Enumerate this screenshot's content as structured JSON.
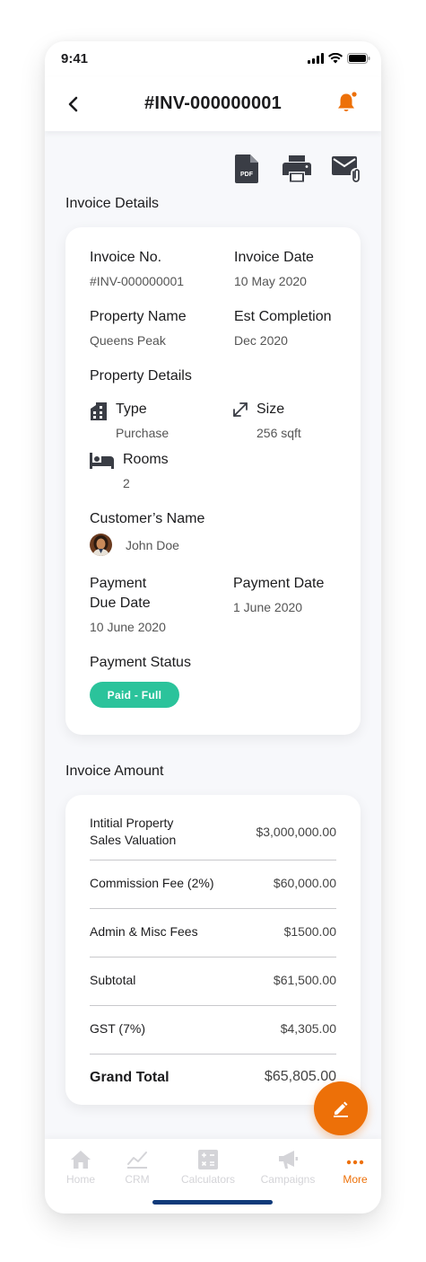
{
  "status_bar": {
    "time": "9:41"
  },
  "header": {
    "title": "#INV-000000001"
  },
  "actions": [
    "pdf-icon",
    "print-icon",
    "mail-attachment-icon"
  ],
  "invoice_details": {
    "section_title": "Invoice Details",
    "invoice_no_label": "Invoice No.",
    "invoice_no": "#INV-000000001",
    "invoice_date_label": "Invoice Date",
    "invoice_date": "10 May 2020",
    "property_name_label": "Property Name",
    "property_name": "Queens Peak",
    "est_completion_label": "Est Completion",
    "est_completion": "Dec 2020",
    "property_details_label": "Property Details",
    "type_label": "Type",
    "type": "Purchase",
    "size_label": "Size",
    "size": "256 sqft",
    "rooms_label": "Rooms",
    "rooms": "2",
    "customer_name_label": "Customer’s Name",
    "customer_name": "John Doe",
    "payment_due_label_line1": "Payment",
    "payment_due_label_line2": "Due Date",
    "payment_due_date": "10 June 2020",
    "payment_date_label": "Payment Date",
    "payment_date": "1 June 2020",
    "payment_status_label": "Payment Status",
    "payment_status": "Paid - Full",
    "status_color": "#2bc39b"
  },
  "invoice_amount": {
    "section_title": "Invoice Amount",
    "rows": [
      {
        "label_line1": "Intitial Property",
        "label_line2": "Sales Valuation",
        "value": "$3,000,000.00"
      },
      {
        "label": "Commission Fee (2%)",
        "value": "$60,000.00"
      },
      {
        "label": "Admin & Misc Fees",
        "value": "$1500.00"
      },
      {
        "label": "Subtotal",
        "value": "$61,500.00"
      },
      {
        "label": "GST (7%)",
        "value": "$4,305.00"
      },
      {
        "label": "Grand Total",
        "value": "$65,805.00"
      }
    ]
  },
  "tabbar": {
    "items": [
      {
        "label": "Home",
        "icon": "home-icon"
      },
      {
        "label": "CRM",
        "icon": "chart-icon"
      },
      {
        "label": "Calculators",
        "icon": "calculator-icon"
      },
      {
        "label": "Campaigns",
        "icon": "megaphone-icon"
      },
      {
        "label": "More",
        "icon": "more-icon"
      }
    ],
    "active": "More"
  },
  "colors": {
    "accent": "#ed7008",
    "background": "#f7f8fb",
    "badge": "#2bc39b",
    "home_indicator": "#103a7a"
  }
}
